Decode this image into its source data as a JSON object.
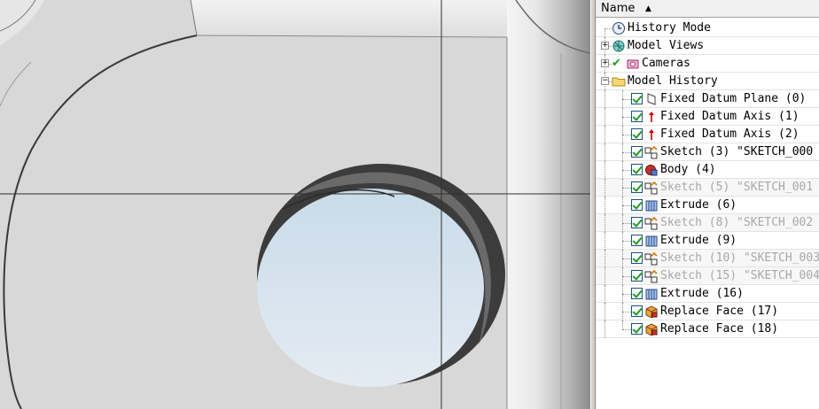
{
  "navigator": {
    "header": {
      "name_column": "Name"
    },
    "items": [
      {
        "label": "History Mode",
        "icon": "clock-icon",
        "level": 0,
        "expander": "",
        "checkbox": false,
        "suppressed": false
      },
      {
        "label": "Model Views",
        "icon": "model-views-icon",
        "level": 0,
        "expander": "+",
        "checkbox": false,
        "suppressed": false
      },
      {
        "label": "Cameras",
        "icon": "camera-icon",
        "level": 0,
        "expander": "+",
        "checkbox": false,
        "green_check": true,
        "suppressed": false
      },
      {
        "label": "Model History",
        "icon": "folder-icon",
        "level": 0,
        "expander": "-",
        "checkbox": false,
        "suppressed": false
      },
      {
        "label": "Fixed Datum Plane (0)",
        "icon": "datum-plane-icon",
        "level": 1,
        "checkbox": true,
        "suppressed": false
      },
      {
        "label": "Fixed Datum Axis (1)",
        "icon": "datum-axis-icon",
        "level": 1,
        "checkbox": true,
        "suppressed": false
      },
      {
        "label": "Fixed Datum Axis (2)",
        "icon": "datum-axis-icon",
        "level": 1,
        "checkbox": true,
        "suppressed": false
      },
      {
        "label": "Sketch (3) \"SKETCH_000",
        "icon": "sketch-icon",
        "level": 1,
        "checkbox": true,
        "suppressed": false
      },
      {
        "label": "Body (4)",
        "icon": "body-icon",
        "level": 1,
        "checkbox": true,
        "suppressed": false
      },
      {
        "label": "Sketch (5) \"SKETCH_001",
        "icon": "sketch-icon",
        "level": 1,
        "checkbox": true,
        "suppressed": true
      },
      {
        "label": "Extrude (6)",
        "icon": "extrude-icon",
        "level": 1,
        "checkbox": true,
        "suppressed": false
      },
      {
        "label": "Sketch (8) \"SKETCH_002",
        "icon": "sketch-icon",
        "level": 1,
        "checkbox": true,
        "suppressed": true
      },
      {
        "label": "Extrude (9)",
        "icon": "extrude-icon",
        "level": 1,
        "checkbox": true,
        "suppressed": false
      },
      {
        "label": "Sketch (10) \"SKETCH_003",
        "icon": "sketch-icon",
        "level": 1,
        "checkbox": true,
        "suppressed": true
      },
      {
        "label": "Sketch (15) \"SKETCH_004",
        "icon": "sketch-icon",
        "level": 1,
        "checkbox": true,
        "suppressed": true
      },
      {
        "label": "Extrude (16)",
        "icon": "extrude-icon",
        "level": 1,
        "checkbox": true,
        "suppressed": false
      },
      {
        "label": "Replace Face (17)",
        "icon": "replace-face-icon",
        "level": 1,
        "checkbox": true,
        "suppressed": false
      },
      {
        "label": "Replace Face (18)",
        "icon": "replace-face-icon",
        "level": 1,
        "checkbox": true,
        "suppressed": false
      }
    ]
  }
}
